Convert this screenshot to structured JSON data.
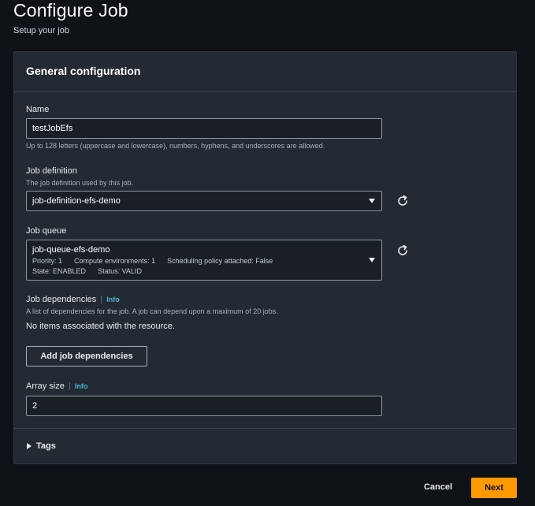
{
  "page": {
    "title": "Configure Job",
    "subtitle": "Setup your job"
  },
  "general": {
    "title": "General configuration",
    "name": {
      "label": "Name",
      "value": "testJobEfs",
      "hint": "Up to 128 letters (uppercase and lowercase), numbers, hyphens, and underscores are allowed."
    },
    "job_definition": {
      "label": "Job definition",
      "description": "The job definition used by this job.",
      "value": "job-definition-efs-demo"
    },
    "job_queue": {
      "label": "Job queue",
      "value": "job-queue-efs-demo",
      "priority": "Priority: 1",
      "compute_environments": "Compute environments: 1",
      "scheduling_policy": "Scheduling policy attached: False",
      "state": "State: ENABLED",
      "status": "Status: VALID"
    },
    "job_dependencies": {
      "label": "Job dependencies",
      "info": "Info",
      "description": "A list of dependencies for the job. A job can depend upon a maximum of 20 jobs.",
      "empty_text": "No items associated with the resource.",
      "add_button": "Add job dependencies"
    },
    "array_size": {
      "label": "Array size",
      "info": "Info",
      "value": "2"
    },
    "tags": {
      "label": "Tags"
    }
  },
  "footer": {
    "cancel": "Cancel",
    "next": "Next"
  },
  "colors": {
    "background": "#0f1217",
    "panel": "#242a33",
    "primary_button": "#ff9900",
    "info_link": "#44b9d6"
  },
  "icons": {
    "refresh": "refresh-icon",
    "dropdown": "caret-down-icon",
    "expand": "caret-right-icon"
  }
}
